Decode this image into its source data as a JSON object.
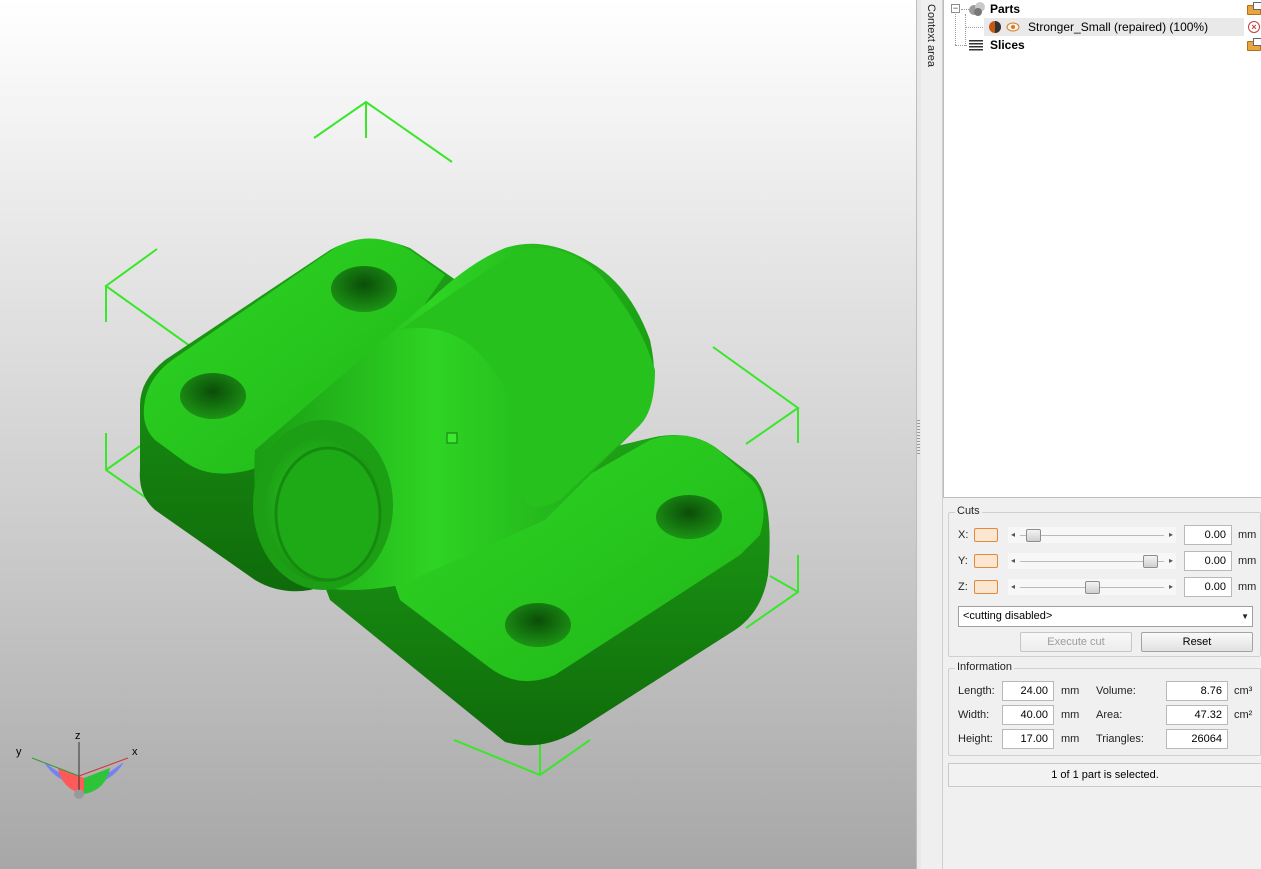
{
  "viewport": {
    "model_color": "#22c51a",
    "bbox_color": "#39e62a",
    "axes": {
      "x_label": "x",
      "y_label": "y",
      "z_label": "z"
    }
  },
  "sidebar": {
    "context_area_label": "Context area"
  },
  "tree": {
    "parts_label": "Parts",
    "part_item_label": "Stronger_Small (repaired) (100%)",
    "slices_label": "Slices",
    "expander_symbol": "−"
  },
  "cuts": {
    "title": "Cuts",
    "rows": [
      {
        "axis": "X:",
        "value": "0.00",
        "unit": "mm",
        "position": 0.05
      },
      {
        "axis": "Y:",
        "value": "0.00",
        "unit": "mm",
        "position": 0.95
      },
      {
        "axis": "Z:",
        "value": "0.00",
        "unit": "mm",
        "position": 0.5
      }
    ],
    "mode_select": "<cutting disabled>",
    "execute_label": "Execute cut",
    "reset_label": "Reset"
  },
  "information": {
    "title": "Information",
    "length": {
      "label": "Length:",
      "value": "24.00",
      "unit": "mm"
    },
    "width": {
      "label": "Width:",
      "value": "40.00",
      "unit": "mm"
    },
    "height": {
      "label": "Height:",
      "value": "17.00",
      "unit": "mm"
    },
    "volume": {
      "label": "Volume:",
      "value": "8.76",
      "unit": "cm³"
    },
    "area": {
      "label": "Area:",
      "value": "47.32",
      "unit": "cm²"
    },
    "triangles": {
      "label": "Triangles:",
      "value": "26064"
    }
  },
  "status": {
    "selection_text": "1 of 1 part is selected."
  }
}
